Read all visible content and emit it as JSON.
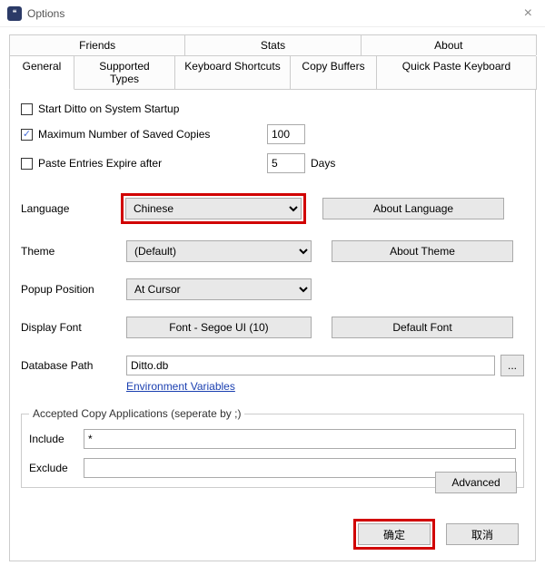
{
  "window": {
    "title": "Options"
  },
  "tabs_row1": [
    "Friends",
    "Stats",
    "About"
  ],
  "tabs_row2": [
    "General",
    "Supported Types",
    "Keyboard Shortcuts",
    "Copy Buffers",
    "Quick Paste Keyboard"
  ],
  "active_tab": "General",
  "startup": {
    "label": "Start Ditto on System Startup",
    "checked": false
  },
  "maxcopies": {
    "label": "Maximum Number of Saved Copies",
    "checked": true,
    "value": "100"
  },
  "expire": {
    "label": "Paste Entries Expire after",
    "checked": false,
    "value": "5",
    "unit": "Days"
  },
  "language": {
    "label": "Language",
    "value": "Chinese",
    "about": "About Language"
  },
  "theme": {
    "label": "Theme",
    "value": "(Default)",
    "about": "About Theme"
  },
  "popup": {
    "label": "Popup Position",
    "value": "At Cursor"
  },
  "font": {
    "label": "Display Font",
    "btn": "Font - Segoe UI (10)",
    "default": "Default Font"
  },
  "db": {
    "label": "Database Path",
    "value": "Ditto.db",
    "browse": "...",
    "env": "Environment Variables"
  },
  "apps": {
    "legend": "Accepted Copy Applications (seperate by ;)",
    "include_label": "Include",
    "include_value": "*",
    "exclude_label": "Exclude",
    "exclude_value": ""
  },
  "advanced": "Advanced",
  "ok": "确定",
  "cancel": "取消"
}
